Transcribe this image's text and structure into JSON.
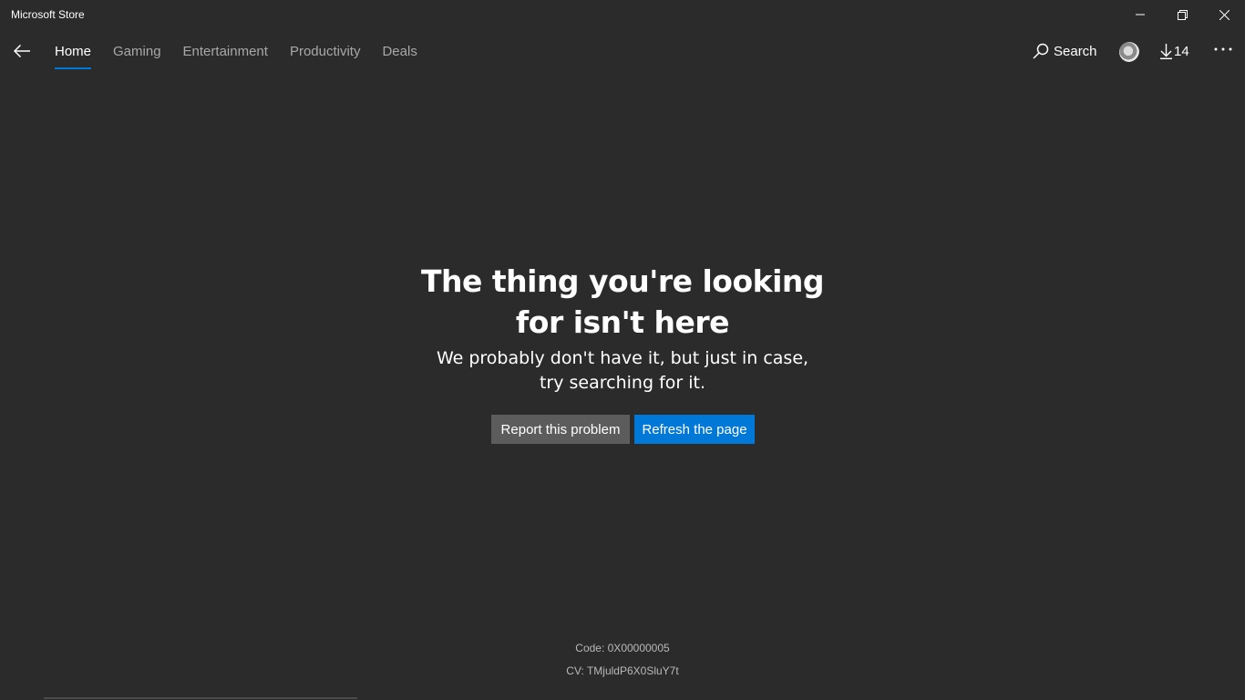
{
  "window": {
    "title": "Microsoft Store",
    "controls": {
      "minimize_icon": "minimize-icon",
      "restore_icon": "restore-icon",
      "close_icon": "close-icon"
    }
  },
  "nav": {
    "back_icon": "back-arrow-icon",
    "tabs": [
      {
        "label": "Home",
        "active": true
      },
      {
        "label": "Gaming",
        "active": false
      },
      {
        "label": "Entertainment",
        "active": false
      },
      {
        "label": "Productivity",
        "active": false
      },
      {
        "label": "Deals",
        "active": false
      }
    ],
    "search_label": "Search",
    "downloads_count": "14",
    "more_icon": "more-ellipsis-icon"
  },
  "error": {
    "heading": "The thing you're looking for isn't here",
    "subtext": "We probably don't have it, but just in case, try searching for it.",
    "report_button": "Report this problem",
    "refresh_button": "Refresh the page",
    "code": "Code: 0X00000005",
    "cv": "CV: TMjuldP6X0SluY7t"
  },
  "colors": {
    "background": "#2b2b2b",
    "accent": "#0078d7",
    "secondary_button": "#5c5c5c"
  }
}
